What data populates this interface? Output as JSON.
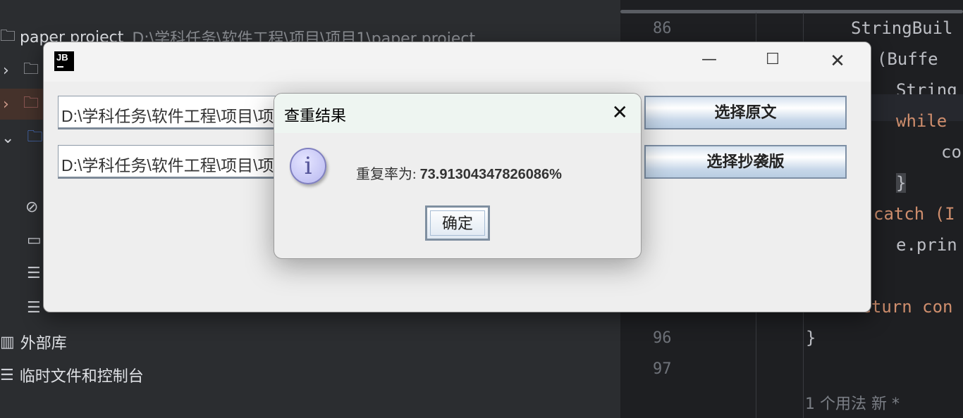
{
  "sidebar": {
    "project_name": "paper project",
    "project_path": "D:\\学科任务\\软件工程\\项目\\项目1\\paper project",
    "external_libs": "外部库",
    "scratches": "临时文件和控制台"
  },
  "editor": {
    "line_numbers": [
      "86",
      "96",
      "97"
    ],
    "lines": [
      "StringBuil",
      "y (Buffe",
      "String",
      "while",
      "co",
      "}",
      "catch (I",
      "e.prin",
      "return con",
      "}"
    ],
    "usage_hint": "1 个用法   新 *"
  },
  "app_window": {
    "icon": "jb-logo",
    "original_path": "D:\\学科任务\\软件工程\\项目\\项目1\\paper project\\论文原版.txt",
    "copy_path": "D:\\学科任务\\软件工程\\项目\\项目1\\paper project\\论文抄袭版.txt",
    "select_original": "选择原文",
    "select_copy": "选择抄袭版"
  },
  "dialog": {
    "title": "查重结果",
    "label": "重复率为: ",
    "value": "73.91304347826086%",
    "ok": "确定",
    "icon": "info-icon"
  }
}
